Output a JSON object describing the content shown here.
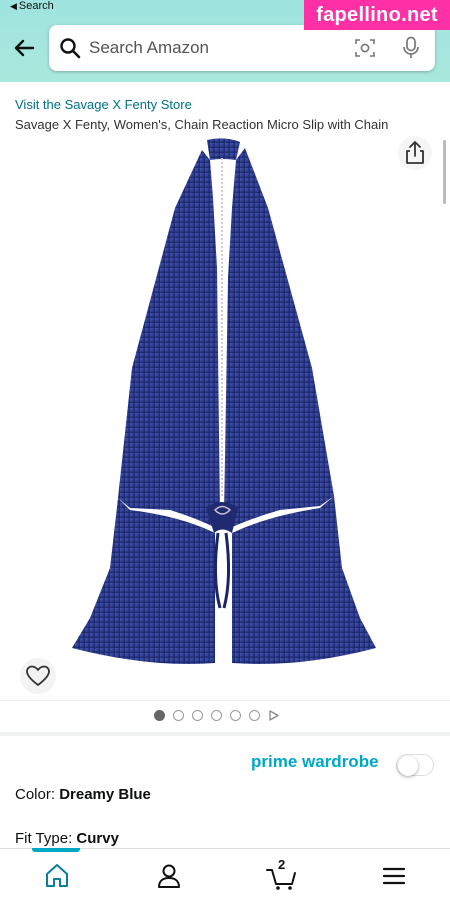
{
  "status_bar": {
    "back_label": "Search"
  },
  "watermark": {
    "text": "fapellino.net"
  },
  "search": {
    "placeholder": "Search Amazon"
  },
  "product": {
    "store_link": "Visit the Savage X Fenty Store",
    "title": "Savage X Fenty, Women's, Chain Reaction Micro Slip with Chain"
  },
  "carousel": {
    "image_count": 6,
    "active_index": 0,
    "has_video": true
  },
  "prime_wardrobe": {
    "label": "prime wardrobe",
    "enabled": false
  },
  "options": {
    "color_label": "Color: ",
    "color_value": "Dreamy Blue",
    "fit_label": "Fit Type: ",
    "fit_value": "Curvy"
  },
  "bottom_nav": {
    "cart_count": "2",
    "active": "home"
  },
  "colors": {
    "header": "#a9e8dc",
    "link": "#007185",
    "prime_accent": "#00a8c5",
    "garment": "#2a3a8c",
    "watermark_bg": "#ff2fa6"
  },
  "icons": [
    "back-arrow-icon",
    "search-icon",
    "camera-icon",
    "microphone-icon",
    "share-icon",
    "heart-icon",
    "home-icon",
    "account-icon",
    "cart-icon",
    "menu-icon"
  ]
}
